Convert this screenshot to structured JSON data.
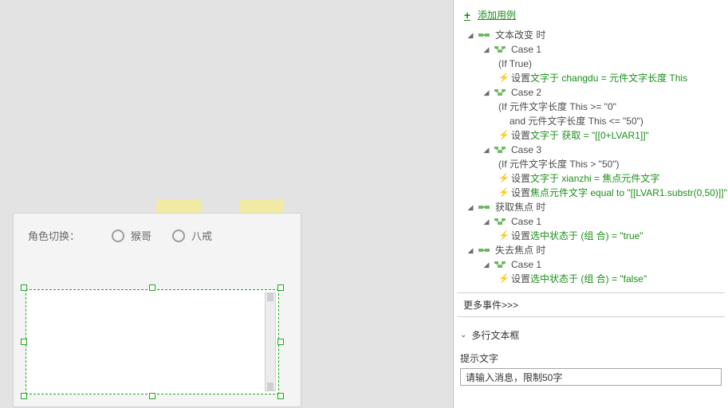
{
  "canvas": {
    "role_label": "角色切换：",
    "radios": [
      "猴哥",
      "八戒"
    ]
  },
  "inspector": {
    "add_case": "添加用例",
    "events": [
      {
        "name": "文本改变 时",
        "cases": [
          {
            "name": "Case 1",
            "condition": "(If True)",
            "actions": [
              {
                "prefix": "设置",
                "body": "文字于 changdu = 元件文字长度 This"
              }
            ]
          },
          {
            "name": "Case 2",
            "condition": "(If 元件文字长度 This >= \"0\"",
            "condition2": "and 元件文字长度 This <= \"50\")",
            "actions": [
              {
                "prefix": "设置",
                "body": "文字于 获取 = \"[[0+LVAR1]]\""
              }
            ]
          },
          {
            "name": "Case 3",
            "condition": "(If 元件文字长度 This > \"50\")",
            "actions": [
              {
                "prefix": "设置",
                "body": "文字于 xianzhi = 焦点元件文字"
              },
              {
                "prefix": "设置",
                "body": "焦点元件文字 equal to \"[[LVAR1.substr(0,50)]]\""
              }
            ]
          }
        ]
      },
      {
        "name": "获取焦点 时",
        "cases": [
          {
            "name": "Case 1",
            "actions": [
              {
                "prefix": "设置",
                "body": "选中状态于 (组 合) = \"true\""
              }
            ]
          }
        ]
      },
      {
        "name": "失去焦点 时",
        "cases": [
          {
            "name": "Case 1",
            "actions": [
              {
                "prefix": "设置",
                "body": "选中状态于 (组 合) = \"false\""
              }
            ]
          }
        ]
      }
    ],
    "more_events": "更多事件>>>",
    "section": "多行文本框",
    "placeholder_label": "提示文字",
    "placeholder_value": "请输入消息，限制50字"
  }
}
